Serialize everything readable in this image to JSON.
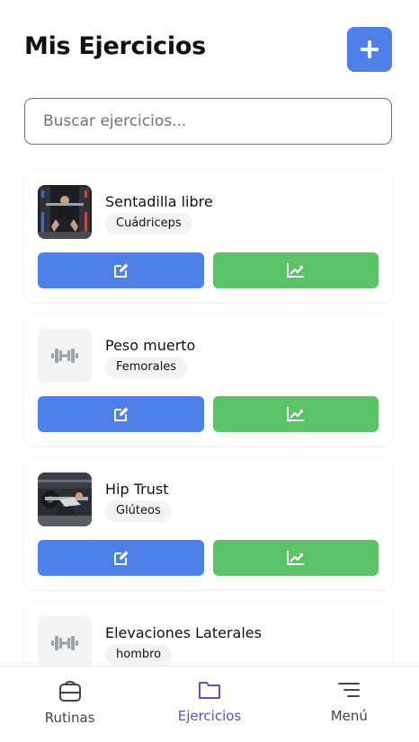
{
  "header": {
    "title": "Mis Ejercicios",
    "add_icon": "plus-icon",
    "accent": "#4f7fe8"
  },
  "search": {
    "placeholder": "Buscar ejercicios...",
    "value": ""
  },
  "exercises": [
    {
      "name": "Sentadilla libre",
      "muscle": "Cuádriceps",
      "image": "photo"
    },
    {
      "name": "Peso muerto",
      "muscle": "Femorales",
      "image": "dumbbell-icon"
    },
    {
      "name": "Hip Trust",
      "muscle": "Glúteos",
      "image": "photo"
    },
    {
      "name": "Elevaciones Laterales",
      "muscle": "hombro",
      "image": "dumbbell-icon"
    }
  ],
  "actions": {
    "edit_icon": "edit-icon",
    "edit_color": "#4f7fe8",
    "stats_icon": "chart-line-icon",
    "stats_color": "#5cc267"
  },
  "nav": [
    {
      "label": "Rutinas",
      "icon": "dumbbell-weight-icon",
      "active": false
    },
    {
      "label": "Ejercicios",
      "icon": "folder-icon",
      "active": true
    },
    {
      "label": "Menú",
      "icon": "menu-icon",
      "active": false
    }
  ],
  "nav_active_color": "#5a4fcf"
}
